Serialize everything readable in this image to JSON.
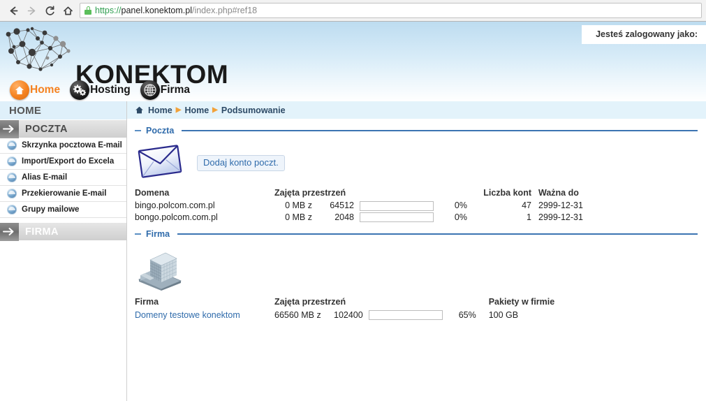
{
  "browser": {
    "back_label": "back",
    "forward_label": "forward",
    "reload_label": "reload",
    "home_label": "home",
    "url_scheme": "https://",
    "url_host": "panel.konektom.pl",
    "url_path": "/index.php#ref18"
  },
  "header": {
    "brand": "KONEKTOM",
    "login_text": "Jesteś zalogowany jako:",
    "nav": [
      {
        "label": "Home",
        "icon": "home-icon",
        "active": true
      },
      {
        "label": "Hosting",
        "icon": "gears-icon",
        "active": false
      },
      {
        "label": "Firma",
        "icon": "globe-icon",
        "active": false
      }
    ]
  },
  "sidebar": {
    "home_label": "HOME",
    "sections": [
      {
        "label": "POCZTA",
        "items": [
          {
            "label": "Skrzynka pocztowa E-mail"
          },
          {
            "label": "Import/Export do Excela"
          },
          {
            "label": "Alias E-mail"
          },
          {
            "label": "Przekierowanie E-mail"
          },
          {
            "label": "Grupy mailowe"
          }
        ]
      },
      {
        "label": "FIRMA",
        "items": []
      }
    ]
  },
  "breadcrumb": {
    "home_icon": "home-icon",
    "items": [
      "Home",
      "Home",
      "Podsumowanie"
    ],
    "separator": "▶"
  },
  "poczta": {
    "section_title": "Poczta",
    "icon": "envelope-icon",
    "add_button": "Dodaj konto poczt.",
    "headers": {
      "domain": "Domena",
      "space": "Zajęta przestrzeń",
      "accounts": "Liczba kont",
      "valid_until": "Ważna do"
    },
    "rows": [
      {
        "domain": "bingo.polcom.com.pl",
        "used": "0 MB z",
        "total": "64512",
        "percent_label": "0%",
        "percent": 0,
        "accounts": "47",
        "valid_until": "2999-12-31"
      },
      {
        "domain": "bongo.polcom.com.pl",
        "used": "0 MB z",
        "total": "2048",
        "percent_label": "0%",
        "percent": 0,
        "accounts": "1",
        "valid_until": "2999-12-31"
      }
    ]
  },
  "firma": {
    "section_title": "Firma",
    "icon": "building-icon",
    "headers": {
      "name": "Firma",
      "space": "Zajęta przestrzeń",
      "packages": "Pakiety w firmie"
    },
    "rows": [
      {
        "name": "Domeny testowe konektom",
        "used": "66560 MB z",
        "total": "102400",
        "percent_label": "65%",
        "percent": 65,
        "packages": "100 GB"
      }
    ]
  },
  "colors": {
    "accent_blue": "#2f6bab",
    "rule_blue": "#3c74b2",
    "breadcrumb_bg": "#e3f3fb",
    "orange": "#f58220",
    "progress_green": "#008a00"
  }
}
